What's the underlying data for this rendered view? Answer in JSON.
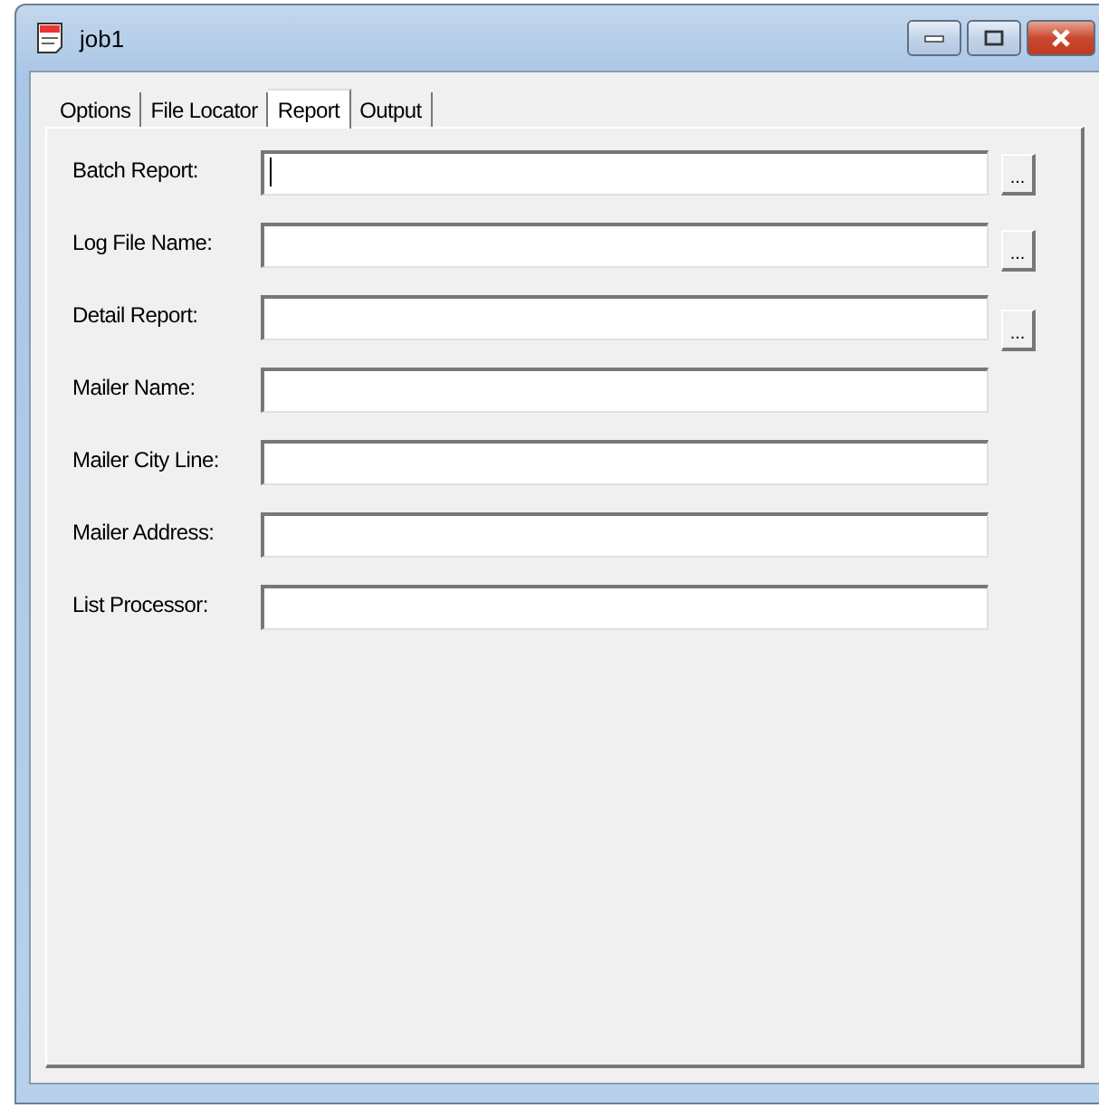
{
  "window": {
    "title": "job1"
  },
  "tabs": [
    {
      "label": "Options",
      "selected": false
    },
    {
      "label": "File Locator",
      "selected": false
    },
    {
      "label": "Report",
      "selected": true
    },
    {
      "label": "Output",
      "selected": false
    }
  ],
  "fields": [
    {
      "label": "Batch Report:",
      "kind": "browse",
      "browse": "...",
      "focused": true
    },
    {
      "label": "Log File Name:",
      "kind": "browse",
      "browse": "...",
      "focused": false
    },
    {
      "label": "Detail Report:",
      "kind": "browse",
      "browse": "...",
      "focused": false
    },
    {
      "label": "Mailer Name:",
      "kind": "text",
      "focused": false
    },
    {
      "label": "Mailer City Line:",
      "kind": "text",
      "focused": false
    },
    {
      "label": "Mailer Address:",
      "kind": "text",
      "focused": false
    },
    {
      "label": "List Processor:",
      "kind": "text",
      "focused": false
    }
  ]
}
